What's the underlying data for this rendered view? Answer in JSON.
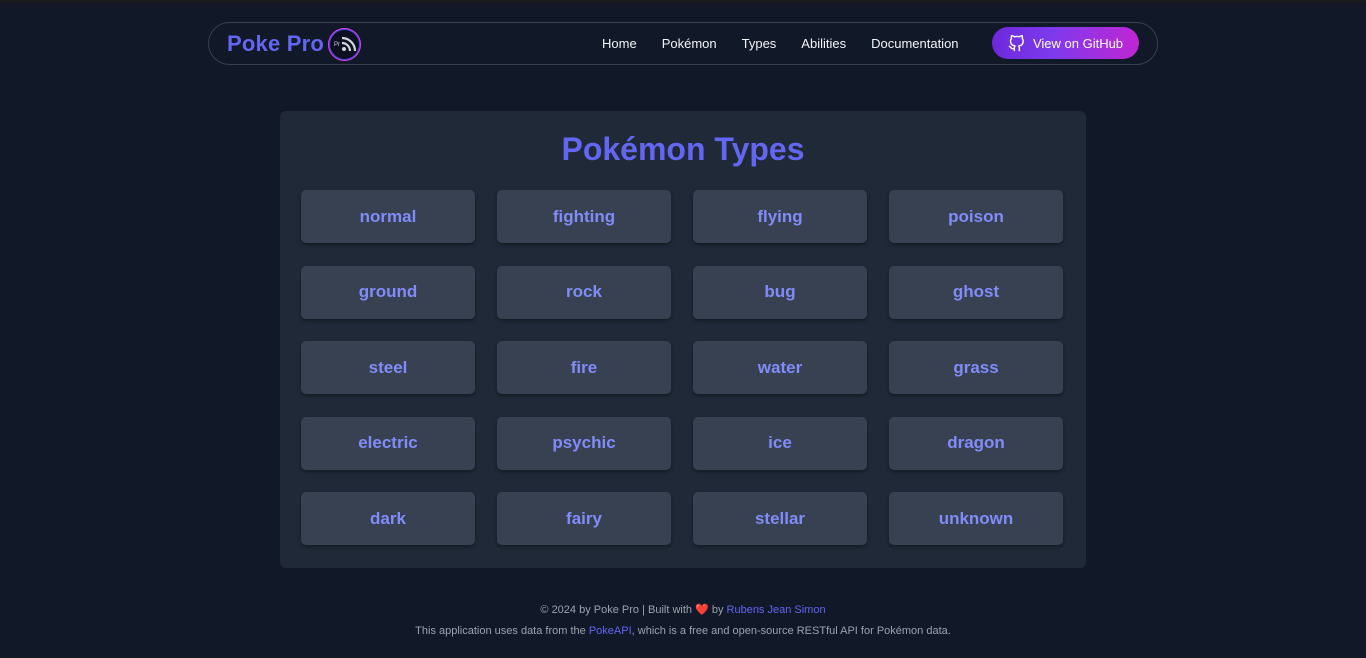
{
  "brand": {
    "name": "Poke Pro",
    "logo_text": "Pr"
  },
  "nav": {
    "items": [
      {
        "label": "Home"
      },
      {
        "label": "Pokémon"
      },
      {
        "label": "Types"
      },
      {
        "label": "Abilities"
      },
      {
        "label": "Documentation"
      }
    ],
    "github_button": "View on GitHub"
  },
  "page": {
    "title": "Pokémon Types"
  },
  "types": [
    "normal",
    "fighting",
    "flying",
    "poison",
    "ground",
    "rock",
    "bug",
    "ghost",
    "steel",
    "fire",
    "water",
    "grass",
    "electric",
    "psychic",
    "ice",
    "dragon",
    "dark",
    "fairy",
    "stellar",
    "unknown"
  ],
  "footer": {
    "copyright": "© 2024 by Poke Pro | Built with",
    "heart": "❤️",
    "by": "by",
    "author": "Rubens Jean Simon",
    "data_prefix": "This application uses data from the",
    "api_link": "PokeAPI",
    "data_suffix": ", which is a free and open-source RESTful API for Pokémon data."
  },
  "colors": {
    "background": "#111827",
    "panel": "#1f2937",
    "card": "#374151",
    "accent": "#6366f1",
    "card_text": "#818cf8"
  }
}
